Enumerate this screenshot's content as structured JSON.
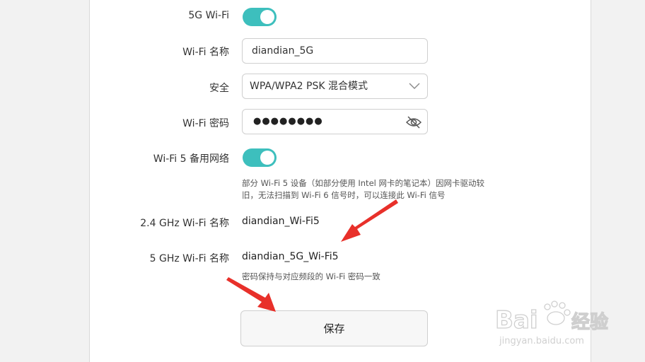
{
  "rows": {
    "wifi_5g_toggle": {
      "label": "5G Wi-Fi",
      "on": true
    },
    "wifi_name": {
      "label": "Wi-Fi 名称",
      "value": "diandian_5G"
    },
    "security": {
      "label": "安全",
      "value": "WPA/WPA2 PSK 混合模式"
    },
    "password": {
      "label": "Wi-Fi 密码",
      "masked": "●●●●●●●●"
    },
    "wifi5_backup": {
      "label": "Wi-Fi 5 备用网络",
      "on": true,
      "note": "部分 Wi-Fi 5 设备（如部分使用 Intel 网卡的笔记本）因网卡驱动较旧，无法扫描到 Wi-Fi 6 信号时，可以连接此 Wi-Fi 信号"
    },
    "name_24": {
      "label": "2.4 GHz Wi-Fi 名称",
      "value": "diandian_Wi-Fi5"
    },
    "name_5": {
      "label": "5 GHz Wi-Fi 名称",
      "value": "diandian_5G_Wi-Fi5",
      "note": "密码保持与对应频段的 Wi-Fi 密码一致"
    }
  },
  "save_label": "保存",
  "watermark": {
    "brand": "Baidu经验",
    "url": "jingyan.baidu.com"
  },
  "colors": {
    "toggle_on": "#3dbfbd",
    "annotation_arrow": "#e8302a"
  }
}
